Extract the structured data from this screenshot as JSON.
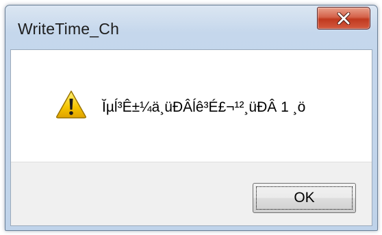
{
  "dialog": {
    "title": "WriteTime_Ch",
    "message": "Ĭµĺ³Ê±¼ä¸üĐÂĺê³É£¬¹²¸üĐÂ 1 ¸ö",
    "ok_label": "OK"
  },
  "icons": {
    "close": "close-icon",
    "warning": "warning-icon"
  },
  "colors": {
    "close_button": "#c7432a",
    "warning_yellow": "#f5c400",
    "title_bar": "#c5d7ec"
  }
}
